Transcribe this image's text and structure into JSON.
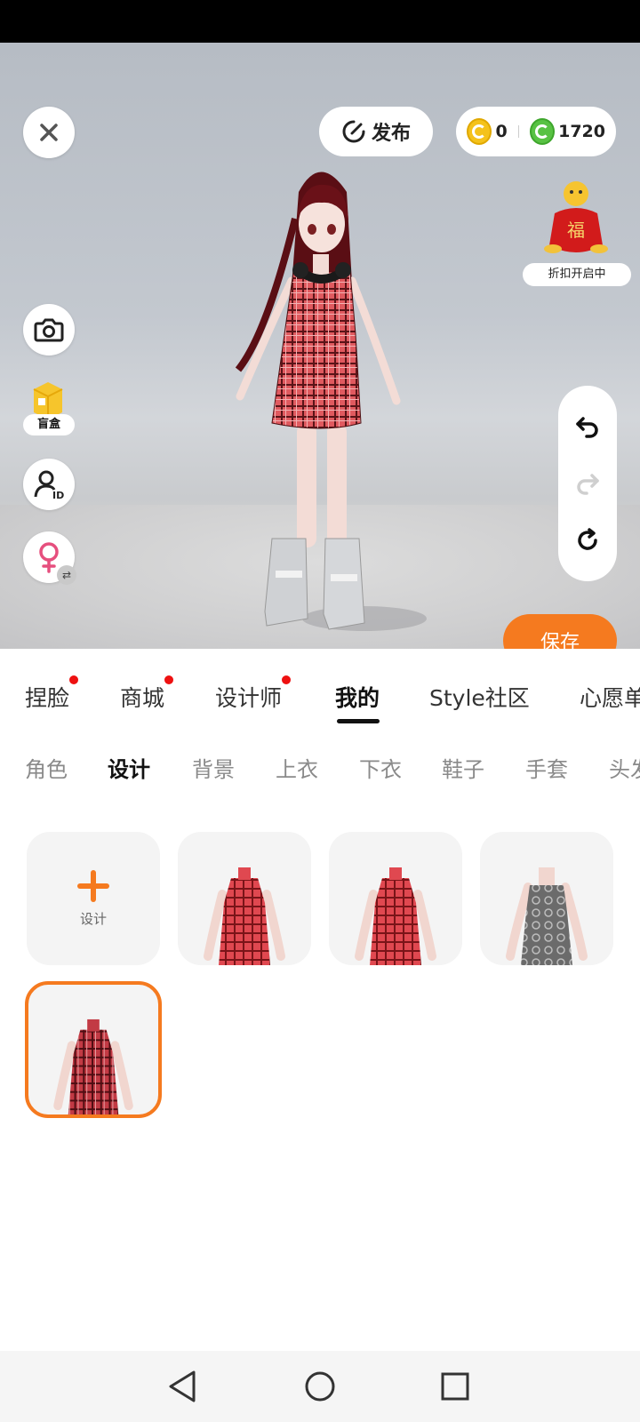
{
  "toolbar": {
    "publish_label": "发布",
    "coins_gold": "0",
    "coins_green": "1720"
  },
  "promo": {
    "label": "折扣开启中",
    "bag_char": "福"
  },
  "side": {
    "blind_box_label": "盲盒",
    "avatar_id_text": "ID"
  },
  "save_label": "保存",
  "tabs": [
    {
      "label": "捏脸",
      "dot": true
    },
    {
      "label": "商城",
      "dot": true
    },
    {
      "label": "设计师",
      "dot": true
    },
    {
      "label": "我的",
      "dot": false,
      "active": true
    },
    {
      "label": "Style社区",
      "dot": false
    },
    {
      "label": "心愿单",
      "dot": false
    }
  ],
  "subtabs": [
    "角色",
    "设计",
    "背景",
    "上衣",
    "下衣",
    "鞋子",
    "手套",
    "头发"
  ],
  "active_subtab": "设计",
  "grid": {
    "add_label": "设计",
    "items": [
      {
        "name": "red-plaid-qipao-1",
        "pattern": "red-plaid"
      },
      {
        "name": "red-plaid-qipao-2",
        "pattern": "red-plaid"
      },
      {
        "name": "grey-lace-dress",
        "pattern": "grey-lace"
      },
      {
        "name": "red-plaid-qipao-selected",
        "pattern": "red-plaid-dark",
        "selected": true
      }
    ]
  },
  "colors": {
    "accent": "#f57a1f",
    "dot": "#ee1111"
  }
}
